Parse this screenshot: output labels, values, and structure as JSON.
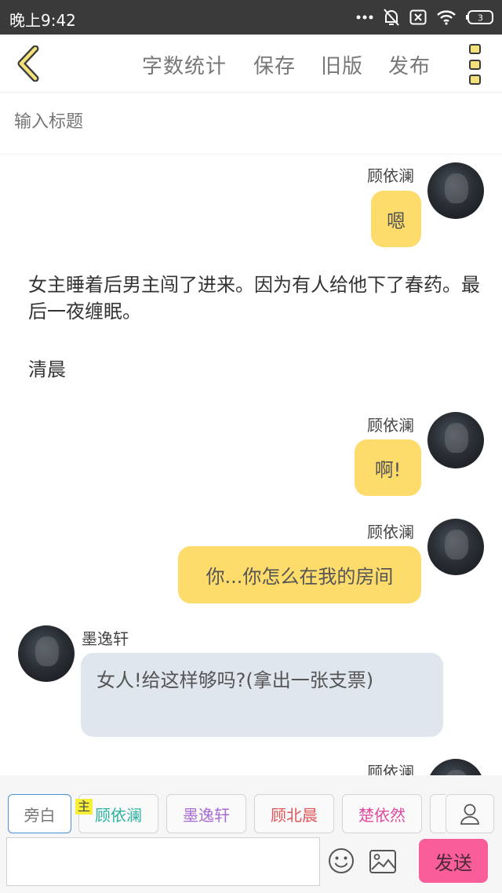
{
  "status_bar": {
    "time": "晚上9:42",
    "icons": [
      "more-dots-icon",
      "mute-bell-icon",
      "sim-off-icon",
      "wifi-icon",
      "battery-icon"
    ],
    "battery_level": "3"
  },
  "toolbar": {
    "back_icon": "chevron-left-icon",
    "actions": [
      "字数统计",
      "保存",
      "旧版",
      "发布"
    ],
    "menu_icon": "more-vertical-icon",
    "accent_color": "#f3e17a"
  },
  "title": {
    "placeholder": "输入标题"
  },
  "story": {
    "m1": {
      "speaker": "顾依澜",
      "text": "嗯"
    },
    "narration1": "女主睡着后男主闯了进来。因为有人给他下了春药。最后一夜缠眠。",
    "narration2": "清晨",
    "m2": {
      "speaker": "顾依澜",
      "text": "啊!"
    },
    "m3": {
      "speaker": "顾依澜",
      "text": "你...你怎么在我的房间"
    },
    "m4": {
      "speaker": "墨逸轩",
      "text": "女人!给这样够吗?(拿出一张支票)"
    },
    "m5": {
      "speaker": "顾依澜"
    }
  },
  "roles": {
    "narrator": {
      "label": "旁白",
      "color": "#777777"
    },
    "lead_tag": "主",
    "items": [
      {
        "label": "顾依澜",
        "color": "#2bb3a0"
      },
      {
        "label": "墨逸轩",
        "color": "#a86bd1"
      },
      {
        "label": "顾北晨",
        "color": "#e0555a"
      },
      {
        "label": "楚依然",
        "color": "#e04aa0"
      }
    ],
    "user_icon": "user-icon"
  },
  "input_bar": {
    "value": "",
    "emoji_icon": "smiley-icon",
    "image_icon": "image-icon",
    "send_label": "发送",
    "send_color": "#f95e9b"
  },
  "colors": {
    "right_bubble": "#fddc6c",
    "left_bubble": "#dfe6ed",
    "status_bar": "#3a3a3a"
  }
}
